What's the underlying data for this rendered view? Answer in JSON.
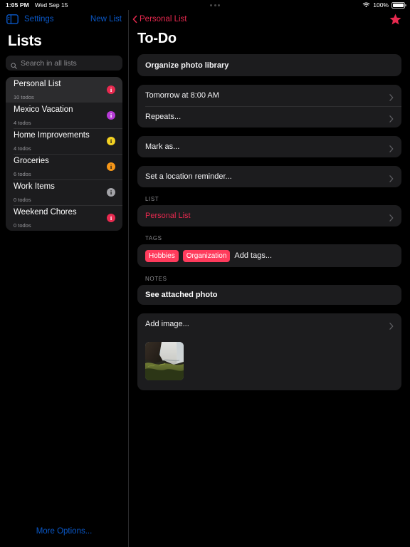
{
  "status_bar": {
    "time": "1:05 PM",
    "date": "Wed Sep 15",
    "battery_percent": "100%",
    "wifi_icon": "wifi-icon",
    "battery_icon": "battery-full-icon",
    "multitask_handle_icon": "multitask-dots-icon"
  },
  "sidebar": {
    "toggle_icon": "sidebar-toggle-icon",
    "settings_label": "Settings",
    "new_list_label": "New List",
    "title": "Lists",
    "search": {
      "placeholder": "Search in all lists",
      "icon": "search-icon",
      "value": ""
    },
    "lists": [
      {
        "name": "Personal List",
        "count": "10 todos",
        "badge_color": "#e8294f",
        "badge_glyph": "i",
        "selected": true
      },
      {
        "name": "Mexico Vacation",
        "count": "4 todos",
        "badge_color": "#b63ad6",
        "badge_glyph": "i",
        "selected": false
      },
      {
        "name": "Home Improvements",
        "count": "4 todos",
        "badge_color": "#f2d022",
        "badge_glyph": "i",
        "selected": false
      },
      {
        "name": "Groceries",
        "count": "6 todos",
        "badge_color": "#f59618",
        "badge_glyph": "i",
        "selected": false
      },
      {
        "name": "Work Items",
        "count": "0 todos",
        "badge_color": "#a3a3a8",
        "badge_glyph": "i",
        "selected": false
      },
      {
        "name": "Weekend Chores",
        "count": "0 todos",
        "badge_color": "#e8294f",
        "badge_glyph": "i",
        "selected": false
      }
    ],
    "more_options_label": "More Options..."
  },
  "detail": {
    "back_label": "Personal List",
    "back_icon": "chevron-left-icon",
    "favorite_icon": "star-filled-icon",
    "favorite_color": "#e8294f",
    "title": "To-Do",
    "todo_title": "Organize photo library",
    "schedule": {
      "due_label": "Tomorrow at 8:00 AM",
      "repeats_label": "Repeats..."
    },
    "mark_as_label": "Mark as...",
    "location_label": "Set a location reminder...",
    "list_section": {
      "header": "LIST",
      "value": "Personal List"
    },
    "tags_section": {
      "header": "TAGS",
      "chips": [
        "Hobbies",
        "Organization"
      ],
      "add_placeholder": "Add tags...",
      "chip_color": "#ff3b5c"
    },
    "notes_section": {
      "header": "NOTES",
      "value": "See attached photo"
    },
    "image_section": {
      "add_label": "Add image...",
      "thumbnail_alt": "waterfall-landscape-photo"
    },
    "chevron_icon": "chevron-right-icon"
  }
}
